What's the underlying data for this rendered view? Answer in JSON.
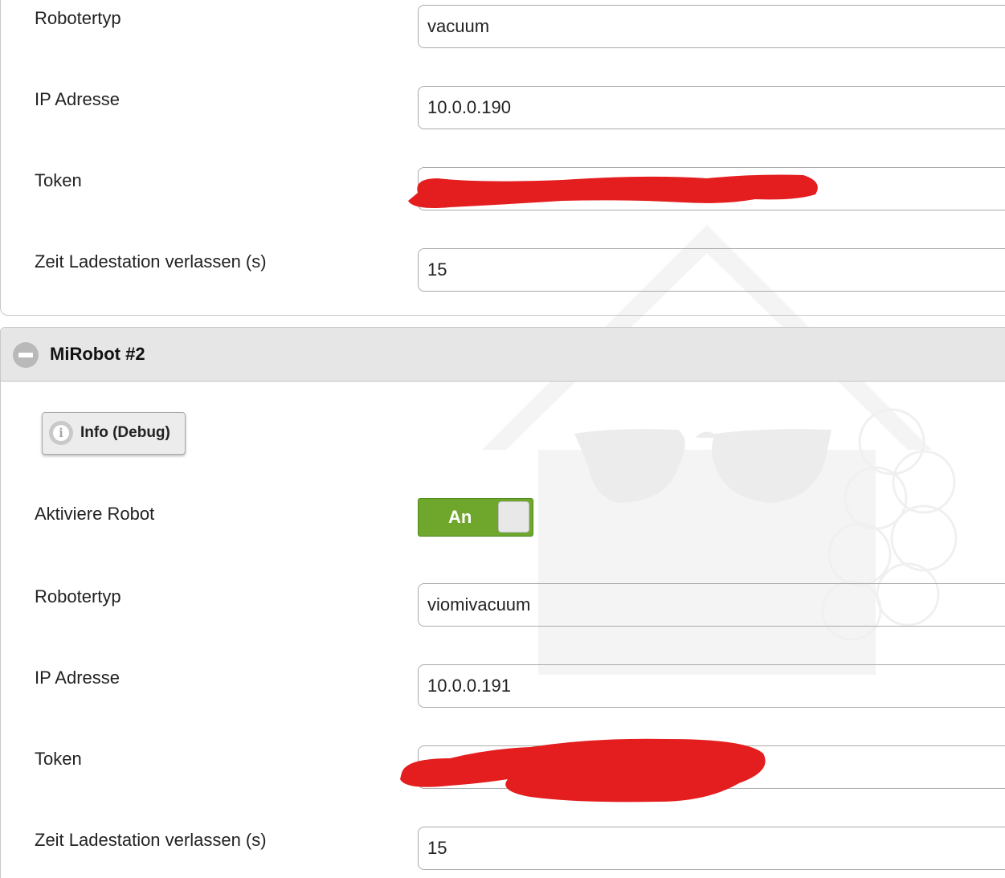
{
  "robot1": {
    "robot_type_label": "Robotertyp",
    "robot_type_value": "vacuum",
    "ip_label": "IP Adresse",
    "ip_value": "10.0.0.190",
    "token_label": "Token",
    "token_value": "",
    "leave_dock_label": "Zeit Ladestation verlassen (s)",
    "leave_dock_value": "15"
  },
  "robot2": {
    "title": "MiRobot #2",
    "info_button_label": "Info (Debug)",
    "activate_label": "Aktiviere Robot",
    "activate_toggle_label": "An",
    "activate_state": true,
    "robot_type_label": "Robotertyp",
    "robot_type_value": "viomivacuum",
    "ip_label": "IP Adresse",
    "ip_value": "10.0.0.191",
    "token_label": "Token",
    "token_value": "",
    "leave_dock_label": "Zeit Ladestation verlassen (s)",
    "leave_dock_value": "15"
  },
  "colors": {
    "toggle_on": "#6fa72c",
    "redaction": "#e41e1e",
    "panel_header": "#e6e6e6"
  },
  "icons": {
    "collapse": "minus-circle-icon",
    "info": "info-circle-icon",
    "watermark": "iobroker-logo-watermark"
  }
}
